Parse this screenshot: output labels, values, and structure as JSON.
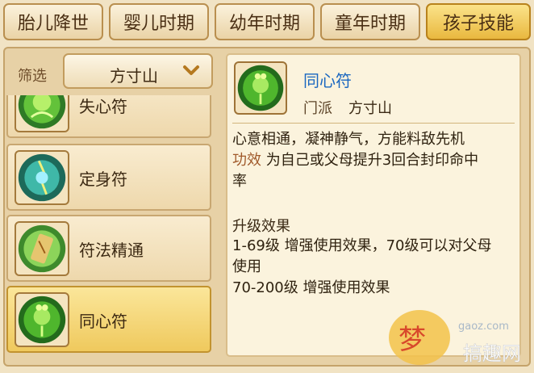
{
  "tabs": [
    {
      "label": "胎儿降世",
      "active": false
    },
    {
      "label": "婴儿时期",
      "active": false
    },
    {
      "label": "幼年时期",
      "active": false
    },
    {
      "label": "童年时期",
      "active": false
    },
    {
      "label": "孩子技能",
      "active": true
    }
  ],
  "filter": {
    "label": "筛选",
    "value": "方寸山"
  },
  "skills": [
    {
      "name": "失心符",
      "icon": "green-spirit-icon"
    },
    {
      "name": "定身符",
      "icon": "lightning-spirit-icon"
    },
    {
      "name": "符法精通",
      "icon": "talisman-scroll-icon"
    },
    {
      "name": "同心符",
      "icon": "clover-spirit-icon",
      "selected": true
    }
  ],
  "detail": {
    "title": "同心符",
    "school_label": "门派",
    "school": "方寸山",
    "description": "心意相通，凝神静气，方能料敌先机",
    "effect_label": "功效",
    "effect_text": " 为自己或父母提升3回合封印命中",
    "effect_text_wrap": "率",
    "upgrade_title": "升级效果",
    "upgrade_lines": [
      "1-69级 增强使用效果，70级可以对父母",
      "使用",
      "70-200级 增强使用效果"
    ]
  },
  "watermark": {
    "site": "gaoz.com",
    "brand": "搞趣网"
  }
}
